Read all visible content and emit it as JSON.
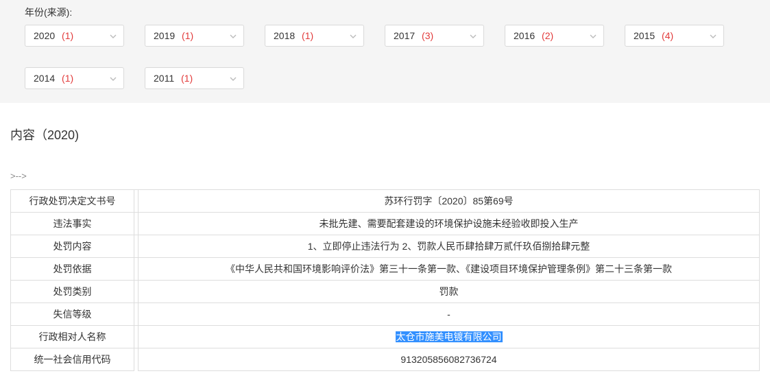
{
  "filter": {
    "label": "年份(来源):",
    "years": [
      {
        "year": "2020",
        "count": "(1)"
      },
      {
        "year": "2019",
        "count": "(1)"
      },
      {
        "year": "2018",
        "count": "(1)"
      },
      {
        "year": "2017",
        "count": "(3)"
      },
      {
        "year": "2016",
        "count": "(2)"
      },
      {
        "year": "2015",
        "count": "(4)"
      },
      {
        "year": "2014",
        "count": "(1)"
      },
      {
        "year": "2011",
        "count": "(1)"
      }
    ]
  },
  "content": {
    "title": "内容（2020)",
    "marker": ">-->",
    "rows": [
      {
        "label": "行政处罚决定文书号",
        "value": "苏环行罚字〔2020〕85第69号"
      },
      {
        "label": "违法事实",
        "value": "未批先建、需要配套建设的环境保护设施未经验收即投入生产"
      },
      {
        "label": "处罚内容",
        "value": "1、立即停止违法行为 2、罚款人民币肆拾肆万贰仟玖佰捌拾肆元整"
      },
      {
        "label": "处罚依据",
        "value": "《中华人民共和国环境影响评价法》第三十一条第一款、《建设项目环境保护管理条例》第二十三条第一款"
      },
      {
        "label": "处罚类别",
        "value": "罚款"
      },
      {
        "label": "失信等级",
        "value": "-"
      },
      {
        "label": "行政相对人名称",
        "value": "太仓市施美电镀有限公司",
        "highlight": true
      },
      {
        "label": "统一社会信用代码",
        "value": "913205856082736724"
      }
    ]
  }
}
